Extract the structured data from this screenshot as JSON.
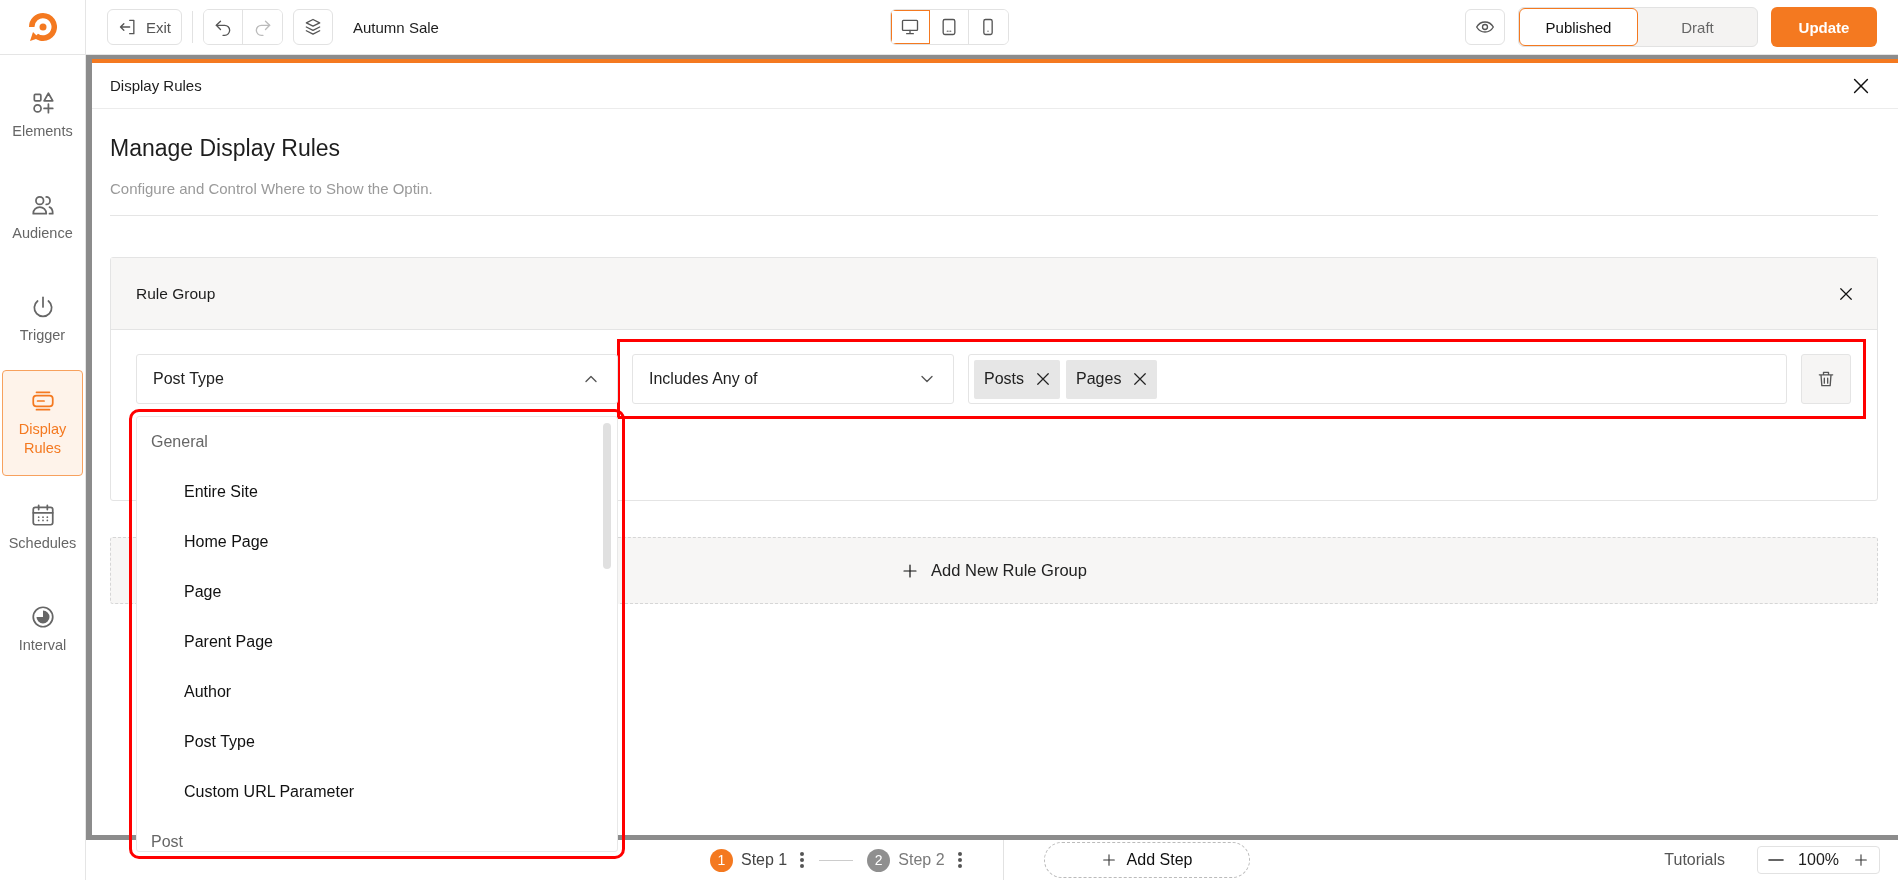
{
  "toolbar": {
    "exit": "Exit",
    "title": "Autumn Sale",
    "devices": [
      {
        "kind": "desktop",
        "selected": true
      },
      {
        "kind": "tablet",
        "selected": false
      },
      {
        "kind": "mobile",
        "selected": false
      }
    ],
    "status": [
      {
        "label": "Published",
        "selected": true
      },
      {
        "label": "Draft",
        "selected": false
      }
    ],
    "update": "Update"
  },
  "sidebar": {
    "items": [
      {
        "kind": "elements",
        "label": "Elements",
        "selected": false
      },
      {
        "kind": "audience",
        "label": "Audience",
        "selected": false
      },
      {
        "kind": "trigger",
        "label": "Trigger",
        "selected": false
      },
      {
        "kind": "display",
        "label": "Display Rules",
        "selected": true
      },
      {
        "kind": "schedules",
        "label": "Schedules",
        "selected": false
      },
      {
        "kind": "interval",
        "label": "Interval",
        "selected": false
      }
    ]
  },
  "modal": {
    "title": "Display Rules",
    "heading": "Manage Display Rules",
    "subtitle": "Configure and Control Where to Show the Optin.",
    "rule_group": {
      "title": "Rule Group",
      "condition": {
        "value": "Post Type",
        "expanded": true,
        "highlighted": true
      },
      "operator": "Includes Any of",
      "values_highlighted": true,
      "tags": [
        "Posts",
        "Pages"
      ],
      "options": [
        {
          "kind": "group",
          "label": "General"
        },
        {
          "kind": "option",
          "label": "Entire Site"
        },
        {
          "kind": "option",
          "label": "Home Page"
        },
        {
          "kind": "option",
          "label": "Page"
        },
        {
          "kind": "option",
          "label": "Parent Page"
        },
        {
          "kind": "option",
          "label": "Author"
        },
        {
          "kind": "option",
          "label": "Post Type"
        },
        {
          "kind": "option",
          "label": "Custom URL Parameter"
        },
        {
          "kind": "group",
          "label": "Post"
        }
      ]
    },
    "add_group": "Add New Rule Group"
  },
  "footer": {
    "steps": [
      {
        "number": "1",
        "label": "Step 1",
        "selected": true
      },
      {
        "number": "2",
        "label": "Step 2",
        "selected": false
      }
    ],
    "add_step": "Add Step",
    "tutorials": "Tutorials",
    "zoom": "100%"
  }
}
